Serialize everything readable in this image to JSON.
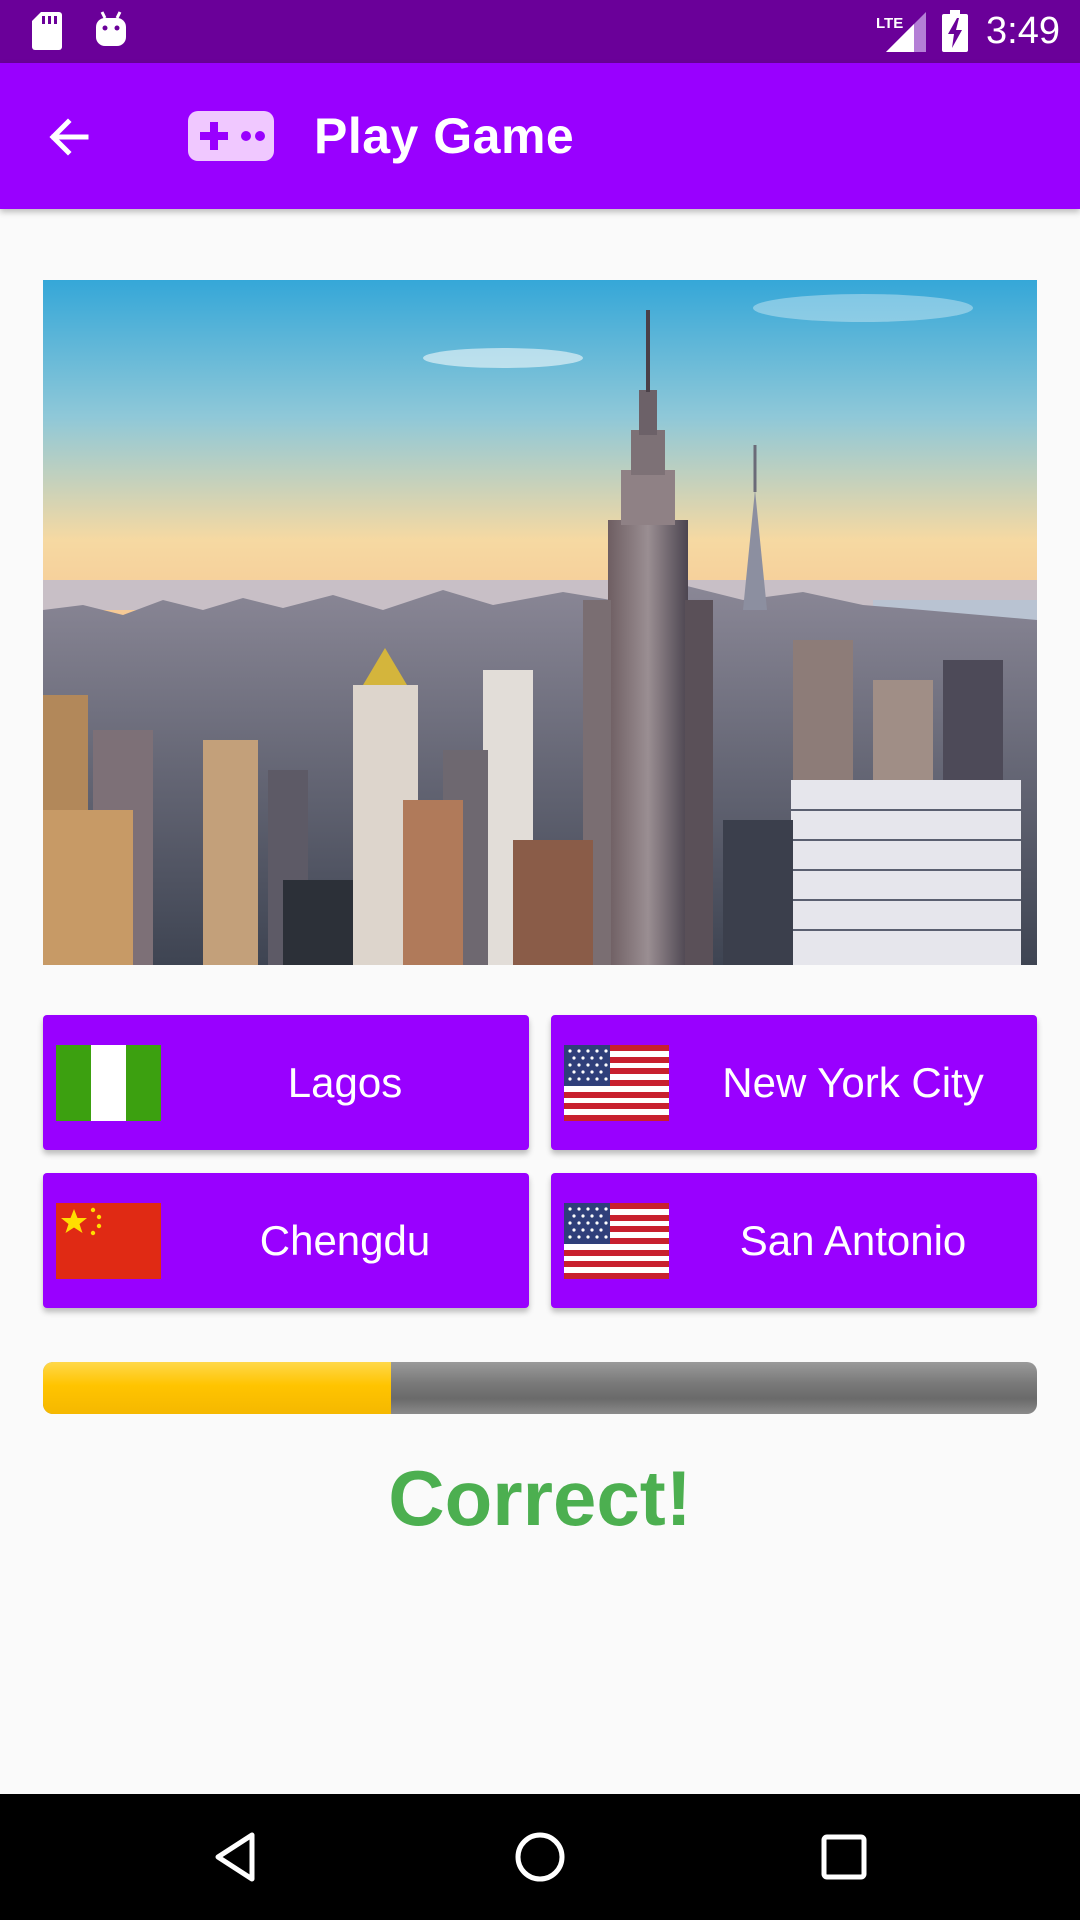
{
  "status_bar": {
    "time": "3:49",
    "network_label": "LTE",
    "icons": [
      "sd-card-icon",
      "android-icon",
      "lte-signal-icon",
      "battery-charging-icon"
    ]
  },
  "app_bar": {
    "title": "Play Game",
    "back_icon": "arrow-left-icon",
    "title_icon": "gamepad-icon",
    "color": "#9900ff"
  },
  "hero_image": {
    "subject": "city-skyline-photo"
  },
  "answers": [
    {
      "label": "Lagos",
      "flag": "nigeria-flag-icon"
    },
    {
      "label": "New York City",
      "flag": "usa-flag-icon"
    },
    {
      "label": "Chengdu",
      "flag": "china-flag-icon"
    },
    {
      "label": "San Antonio",
      "flag": "usa-flag-icon"
    }
  ],
  "progress": {
    "value": 0.35,
    "fill_color": "#ffc400",
    "track_color": "#7a7a7a"
  },
  "result": {
    "text": "Correct!",
    "color": "#4caf50"
  },
  "nav_bar": {
    "buttons": [
      "back-triangle-icon",
      "home-circle-icon",
      "recents-square-icon"
    ]
  }
}
